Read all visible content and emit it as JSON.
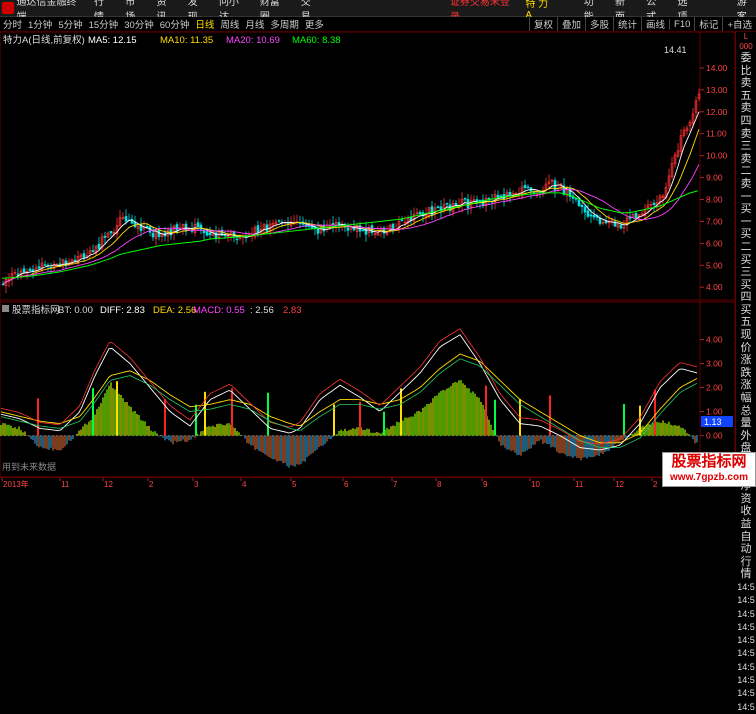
{
  "menubar": {
    "app_title": "通达信金融终端",
    "items": [
      "行情",
      "市场",
      "资讯",
      "发现",
      "问小达",
      "财富圈",
      "交易"
    ],
    "login_text": "证券交易未登录",
    "stock_name": "特 力A",
    "right_items": [
      "功能",
      "新面",
      "公式",
      "选项"
    ],
    "guest": "游客"
  },
  "toolbar": {
    "timeframes": [
      "分时",
      "1分钟",
      "5分钟",
      "15分钟",
      "30分钟",
      "60分钟",
      "日线",
      "周线",
      "月线",
      "多周期",
      "更多"
    ],
    "active_timeframe": "日线",
    "buttons": [
      "复权",
      "叠加",
      "多股",
      "统计",
      "画线",
      "F10",
      "标记",
      "+自选"
    ]
  },
  "main": {
    "header": {
      "title": "特力A(日线,前复权)",
      "ma5": "MA5: 12.15",
      "ma10": "MA10: 11.35",
      "ma20": "MA20: 10.69",
      "ma60": "MA60: 8.38"
    },
    "high_label": "14.41",
    "y_ticks": [
      "14.00",
      "13.00",
      "12.00",
      "11.00",
      "10.00",
      "9.00",
      "8.00",
      "7.00",
      "6.00",
      "5.00",
      "4.00"
    ],
    "y_range": [
      3.6,
      15.0
    ]
  },
  "indicator": {
    "header": {
      "name": "股票指标网",
      "bt": "BT: 0.00",
      "diff": "DIFF: 2.83",
      "dea": "DEA: 2.56",
      "macd": "MACD: 0.55",
      "v1": ": 2.56",
      "v2": "2.83"
    },
    "y_ticks": [
      "4.00",
      "3.00",
      "2.00",
      "1.00",
      "0.00",
      "-1.00"
    ],
    "y_range": [
      -1.6,
      4.9
    ],
    "current_label": "1.13",
    "footer_note": "用到未来数据"
  },
  "date_axis": {
    "labels": [
      "2013年",
      "11",
      "12",
      "2",
      "3",
      "4",
      "5",
      "6",
      "7",
      "8",
      "9",
      "10",
      "11",
      "12",
      "2"
    ]
  },
  "right_panel": {
    "top_small": "L",
    "top_code": "000",
    "items": [
      "委比",
      "卖五",
      "卖四",
      "卖三",
      "卖二",
      "卖一",
      "买一",
      "买二",
      "买三",
      "买四",
      "买五",
      "现价",
      "涨跌",
      "涨幅",
      "总量",
      "外盘",
      "换手",
      "净资",
      "收益"
    ],
    "lower_items": [
      "自动",
      "行情"
    ],
    "times": [
      "14:5",
      "14:5",
      "14:5",
      "14:5",
      "14:5",
      "14:5",
      "14:5",
      "14:5",
      "14:5",
      "14:5"
    ]
  },
  "watermark": {
    "line1": "股票指标网",
    "line2": "www.7gpzb.com"
  },
  "chart_data": [
    {
      "type": "candlestick",
      "y_range": [
        3.6,
        15.0
      ],
      "series": [
        {
          "name": "MA5",
          "color": "#ffffff"
        },
        {
          "name": "MA10",
          "color": "#ffdd00"
        },
        {
          "name": "MA20",
          "color": "#ff44ff"
        },
        {
          "name": "MA60",
          "color": "#00ff00"
        }
      ],
      "x": [
        0,
        30,
        60,
        90,
        110,
        120,
        140,
        160,
        180,
        200,
        210,
        240,
        260,
        280,
        300,
        320,
        340,
        360,
        380,
        400,
        420,
        440,
        460,
        480,
        500,
        520,
        540,
        550,
        560,
        570,
        580,
        590,
        600,
        610,
        620,
        630,
        640,
        650,
        660,
        670,
        680,
        690,
        698
      ],
      "close": [
        4.3,
        4.8,
        5.1,
        5.5,
        6.6,
        7.0,
        6.6,
        6.4,
        6.8,
        6.6,
        6.4,
        6.3,
        6.6,
        7.1,
        6.7,
        6.6,
        6.8,
        6.6,
        6.5,
        6.9,
        7.3,
        7.6,
        7.8,
        7.9,
        8.1,
        8.4,
        8.5,
        8.7,
        8.5,
        8.2,
        7.8,
        7.1,
        7.0,
        6.9,
        6.9,
        7.0,
        7.5,
        7.7,
        8.0,
        9.3,
        10.7,
        11.7,
        12.8
      ],
      "ma60": [
        4.4,
        4.5,
        4.7,
        5.0,
        5.3,
        5.5,
        5.7,
        5.9,
        6.0,
        6.1,
        6.2,
        6.3,
        6.4,
        6.5,
        6.6,
        6.7,
        6.8,
        6.9,
        7.0,
        7.1,
        7.3,
        7.5,
        7.7,
        7.9,
        8.1,
        8.2,
        8.3,
        8.3,
        8.3,
        8.2,
        8.0,
        7.8,
        7.6,
        7.5,
        7.4,
        7.4,
        7.5,
        7.6,
        7.7,
        7.9,
        8.1,
        8.3,
        8.4
      ]
    },
    {
      "type": "bar",
      "name": "MACD",
      "y_range": [
        -1.6,
        4.9
      ],
      "x": [
        0,
        20,
        40,
        60,
        80,
        95,
        110,
        130,
        150,
        170,
        190,
        210,
        230,
        250,
        270,
        290,
        300,
        320,
        340,
        360,
        380,
        400,
        420,
        440,
        460,
        480,
        500,
        520,
        540,
        560,
        580,
        600,
        620,
        640,
        660,
        680,
        698
      ],
      "values": [
        0.5,
        0.3,
        -0.5,
        -0.6,
        0.2,
        0.9,
        2.2,
        1.2,
        0.3,
        -0.3,
        -0.2,
        0.4,
        0.5,
        -0.4,
        -0.9,
        -1.3,
        -1.2,
        -0.5,
        0.2,
        0.3,
        0.1,
        0.6,
        1.0,
        1.8,
        2.3,
        1.5,
        -0.4,
        -0.8,
        -0.2,
        -0.7,
        -1.0,
        -0.8,
        -0.3,
        0.3,
        0.6,
        0.4,
        -0.4
      ],
      "diff": [
        0.9,
        0.7,
        0.3,
        0.2,
        1.0,
        2.5,
        3.7,
        3.0,
        2.0,
        1.0,
        0.4,
        1.5,
        1.9,
        1.1,
        0.3,
        0.1,
        0.3,
        1.5,
        2.1,
        1.6,
        1.0,
        1.8,
        2.6,
        3.7,
        4.2,
        3.0,
        1.5,
        0.5,
        0.4,
        0.0,
        -0.5,
        -0.6,
        -0.4,
        0.5,
        2.0,
        2.8,
        2.6
      ],
      "dea": [
        1.0,
        0.8,
        0.6,
        0.5,
        0.8,
        1.6,
        2.5,
        2.7,
        2.3,
        1.7,
        1.2,
        1.3,
        1.5,
        1.3,
        0.8,
        0.5,
        0.4,
        1.0,
        1.5,
        1.5,
        1.3,
        1.5,
        2.0,
        2.8,
        3.4,
        3.1,
        2.3,
        1.5,
        1.0,
        0.5,
        0.0,
        -0.3,
        -0.3,
        0.1,
        1.1,
        2.0,
        2.4
      ]
    }
  ]
}
